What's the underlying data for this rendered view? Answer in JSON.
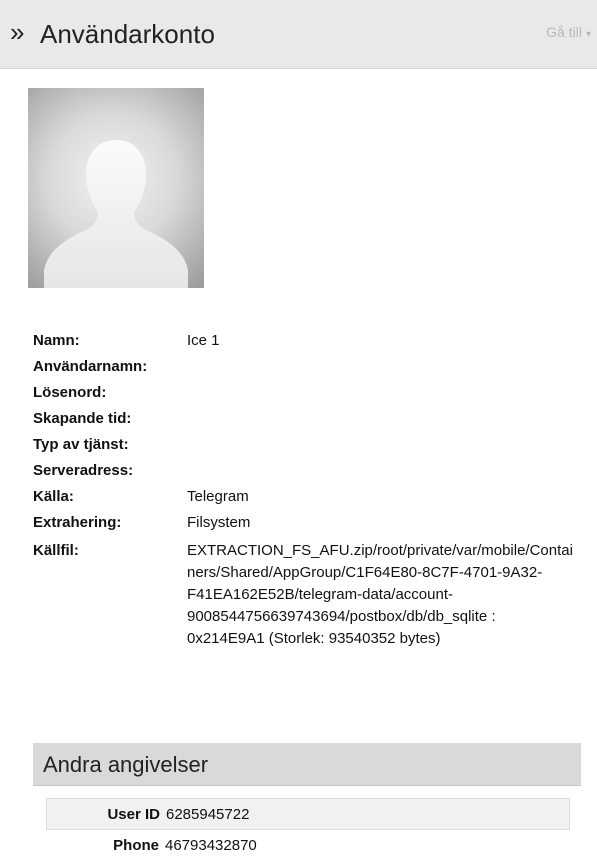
{
  "header": {
    "chevron": "»",
    "title": "Användarkonto",
    "goto_label": "Gå till",
    "goto_caret": "▾"
  },
  "avatar": {
    "icon": "user-silhouette-icon"
  },
  "details": {
    "rows": [
      {
        "label": "Namn:",
        "value": "Ice 1"
      },
      {
        "label": "Användarnamn:",
        "value": ""
      },
      {
        "label": "Lösenord:",
        "value": ""
      },
      {
        "label": "Skapande tid:",
        "value": ""
      },
      {
        "label": "Typ av tjänst:",
        "value": ""
      },
      {
        "label": "Serveradress:",
        "value": ""
      },
      {
        "label": "Källa:",
        "value": "Telegram"
      },
      {
        "label": "Extrahering:",
        "value": "Filsystem"
      }
    ],
    "source_file": {
      "label": "Källfil:",
      "value": "EXTRACTION_FS_AFU.zip/root/private/var/mobile/Containers/Shared/AppGroup/C1F64E80-8C7F-4701-9A32-F41EA162E52B/telegram-data/account-9008544756639743694/postbox/db/db_sqlite : 0x214E9A1 (Storlek: 93540352 bytes)"
    }
  },
  "other": {
    "title": "Andra angivelser",
    "rows": [
      {
        "key": "User ID",
        "value": "6285945722"
      },
      {
        "key": "Phone",
        "value": "46793432870"
      }
    ]
  }
}
